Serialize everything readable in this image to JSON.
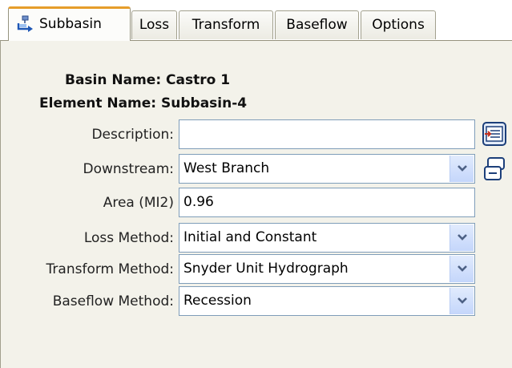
{
  "tabs": [
    {
      "label": "Subbasin",
      "icon": "subbasin-icon",
      "active": true
    },
    {
      "label": "Loss",
      "active": false
    },
    {
      "label": "Transform",
      "active": false
    },
    {
      "label": "Baseflow",
      "active": false
    },
    {
      "label": "Options",
      "active": false
    }
  ],
  "header": {
    "basin_name": "Basin Name: Castro 1",
    "element_name": "Element Name: Subbasin-4"
  },
  "form": {
    "description": {
      "label": "Description:",
      "value": ""
    },
    "downstream": {
      "label": "Downstream:",
      "value": "West Branch"
    },
    "area": {
      "label": "Area (MI2)",
      "value": "0.96"
    },
    "loss_method": {
      "label": "Loss Method:",
      "value": "Initial and Constant"
    },
    "transform_method": {
      "label": "Transform Method:",
      "value": "Snyder Unit Hydrograph"
    },
    "baseflow_method": {
      "label": "Baseflow Method:",
      "value": "Recession"
    }
  },
  "icons": {
    "description_side": "edit-description-icon",
    "downstream_side": "select-element-icon",
    "dropdown": "chevron-down-icon"
  },
  "colors": {
    "active_tab_accent": "#e69d2b",
    "panel_bg": "#f3f2ea",
    "field_border": "#7f9db9"
  }
}
